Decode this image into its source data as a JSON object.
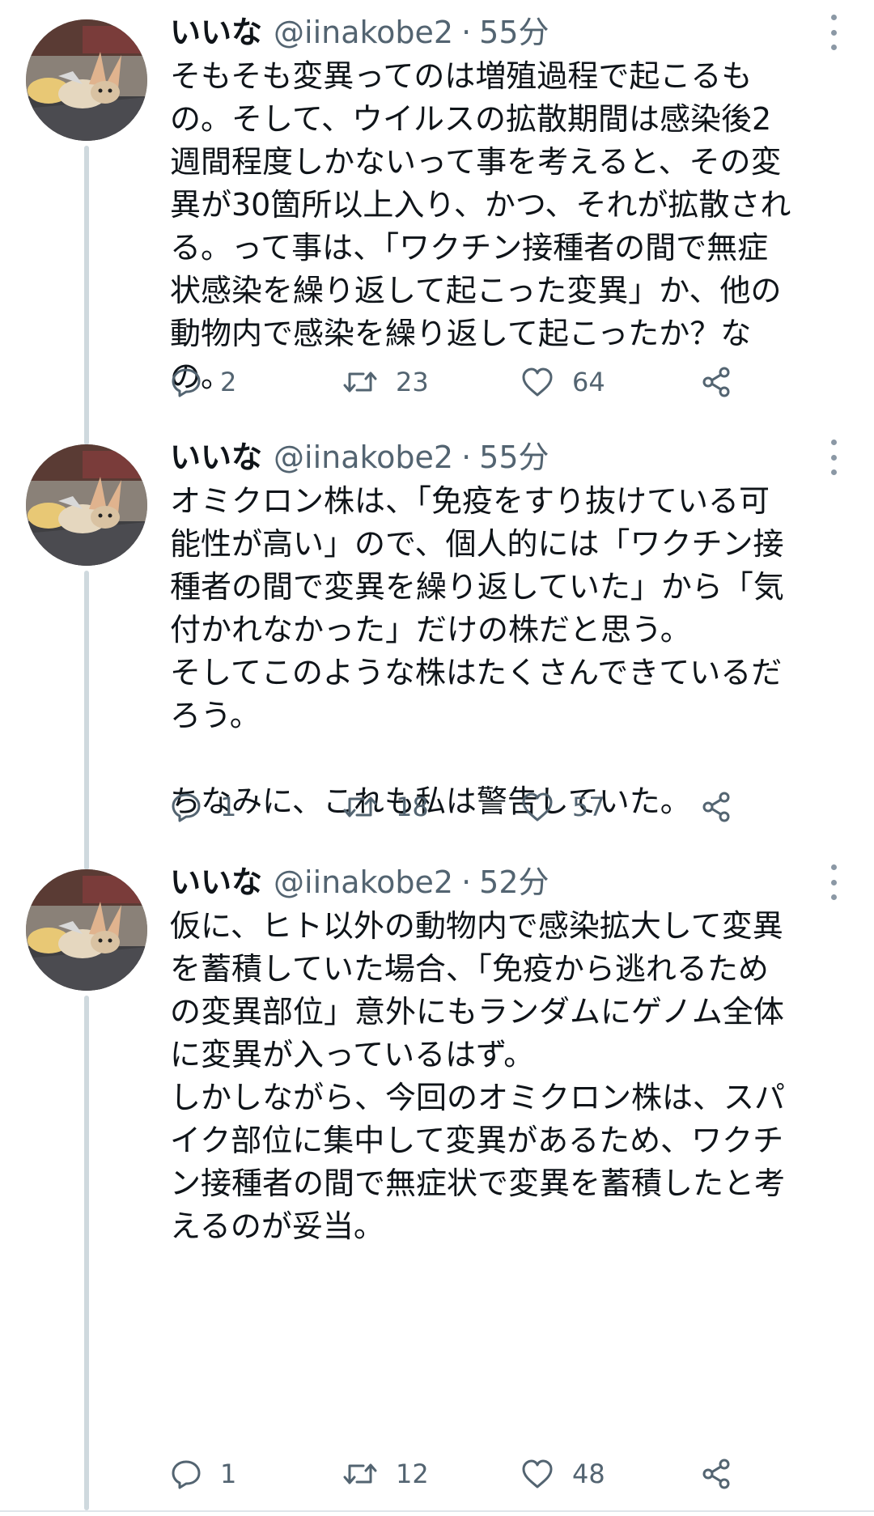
{
  "tweets": [
    {
      "name": "いいな",
      "handle": "@iinakobe2",
      "separator": "·",
      "time": "55分",
      "text": "そもそも変異ってのは増殖過程で起こるも\nの。そして、ウイルスの拡散期間は感染後2\n週間程度しかないって事を考えると、その変\n異が30箇所以上入り、かつ、それが拡散され\nる。って事は、「ワクチン接種者の間で無症\n状感染を繰り返して起こった変異」か、他の\n動物内で感染を繰り返して起こったか？な\nの。",
      "replies": "2",
      "retweets": "23",
      "likes": "64"
    },
    {
      "name": "いいな",
      "handle": "@iinakobe2",
      "separator": "·",
      "time": "55分",
      "text": "オミクロン株は、「免疫をすり抜けている可\n能性が高い」ので、個人的には「ワクチン接\n種者の間で変異を繰り返していた」から「気\n付かれなかった」だけの株だと思う。\nそしてこのような株はたくさんできているだ\nろう。\n\nちなみに、これも私は警告していた。",
      "replies": "1",
      "retweets": "18",
      "likes": "57"
    },
    {
      "name": "いいな",
      "handle": "@iinakobe2",
      "separator": "·",
      "time": "52分",
      "text": "仮に、ヒト以外の動物内で感染拡大して変異\nを蓄積していた場合、「免疫から逃れるため\nの変異部位」意外にもランダムにゲノム全体\nに変異が入っているはず。\nしかしながら、今回のオミクロン株は、スパ\nイク部位に集中して変異があるため、ワクチ\nン接種者の間で無症状で変異を蓄積したと考\nえるのが妥当。",
      "replies": "1",
      "retweets": "12",
      "likes": "48"
    }
  ],
  "icons": {
    "more": "more-vertical-icon",
    "reply": "reply-bubble-icon",
    "retweet": "retweet-icon",
    "like": "heart-icon",
    "share": "share-icon",
    "avatar": "fennec-fox-avatar"
  },
  "colors": {
    "text": "#0f1419",
    "secondary": "#536471",
    "thread_line": "#cfd9de",
    "background": "#ffffff"
  }
}
